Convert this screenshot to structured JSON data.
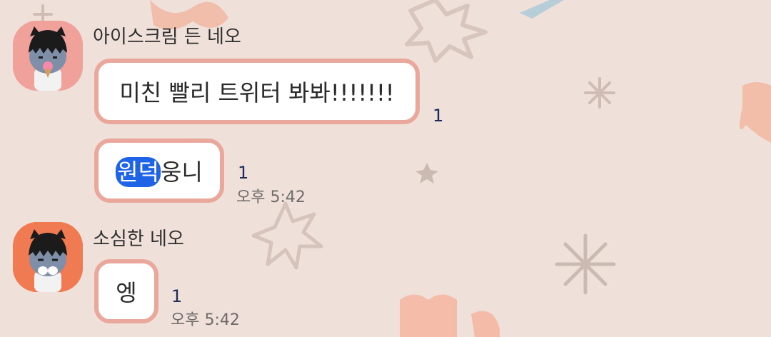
{
  "chat": {
    "messages": [
      {
        "sender": "아이스크림 든 네오",
        "avatar_icon": "neo-icecream-avatar-icon",
        "avatar_bg": "#f0a19a",
        "bubbles": [
          {
            "text": "미친 빨리 트위터 봐봐!!!!!!!",
            "unread": "1"
          },
          {
            "highlight": "원덕",
            "rest": "웅니",
            "unread": "1",
            "time": "오후 5:42"
          }
        ]
      },
      {
        "sender": "소심한 네오",
        "avatar_icon": "neo-shy-avatar-icon",
        "avatar_bg": "#f07a52",
        "bubbles": [
          {
            "text": "엥",
            "unread": "1",
            "time": "오후 5:42"
          }
        ]
      }
    ]
  },
  "colors": {
    "background": "#efe1da",
    "bubble_border": "#eaa89c",
    "highlight": "#1f63e6",
    "unread_text": "#1e2b5a"
  }
}
